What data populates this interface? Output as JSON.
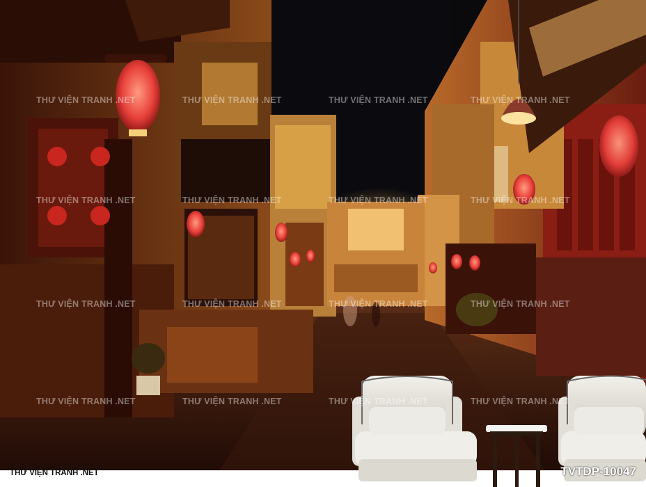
{
  "watermark_text": "THƯ VIỆN TRANH .NET",
  "footer": {
    "brand": "THƯ VIỆN TRANH .NET",
    "product_code": "TVTDP-10047"
  },
  "scene": {
    "subject": "night street with red lanterns and two armchairs with side table",
    "colors": {
      "sky": "#0a0a0c",
      "glow": "#f5b84a",
      "lantern": "#e8403a",
      "wood": "#5a2410",
      "chair": "#e6e4de"
    }
  }
}
